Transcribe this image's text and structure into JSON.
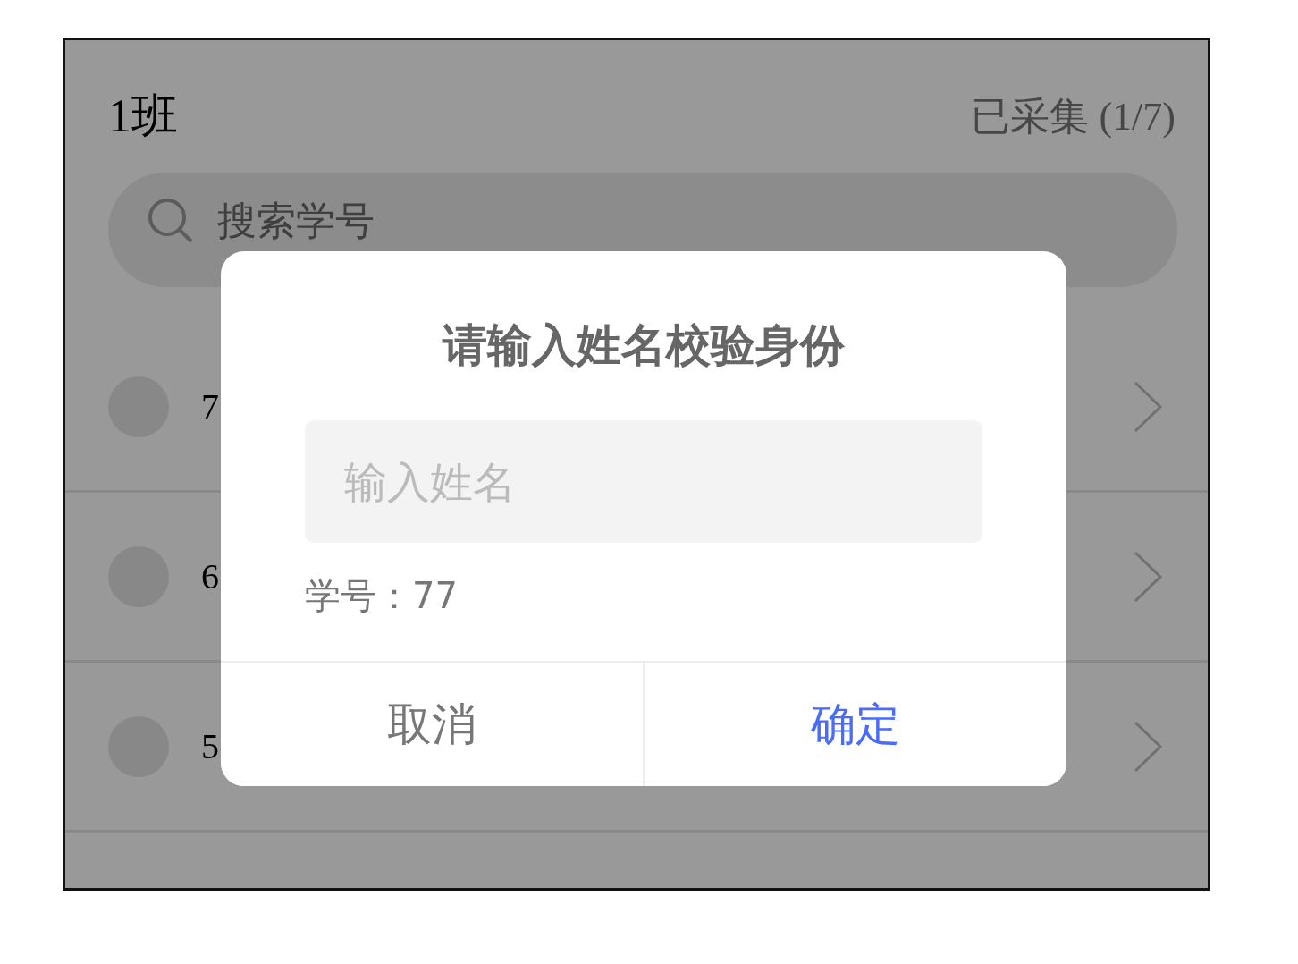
{
  "header": {
    "title": "1班",
    "collected": "已采集 (1/7)"
  },
  "search": {
    "placeholder": "搜索学号"
  },
  "rows": [
    {
      "number": "7"
    },
    {
      "number": "6"
    },
    {
      "number": "5"
    }
  ],
  "dialog": {
    "title": "请输入姓名校验身份",
    "input": {
      "placeholder": "输入姓名"
    },
    "student_id": "学号：77",
    "buttons": [
      {
        "label": "取消",
        "kind": "cancel"
      },
      {
        "label": "确定",
        "kind": "confirm"
      }
    ]
  }
}
